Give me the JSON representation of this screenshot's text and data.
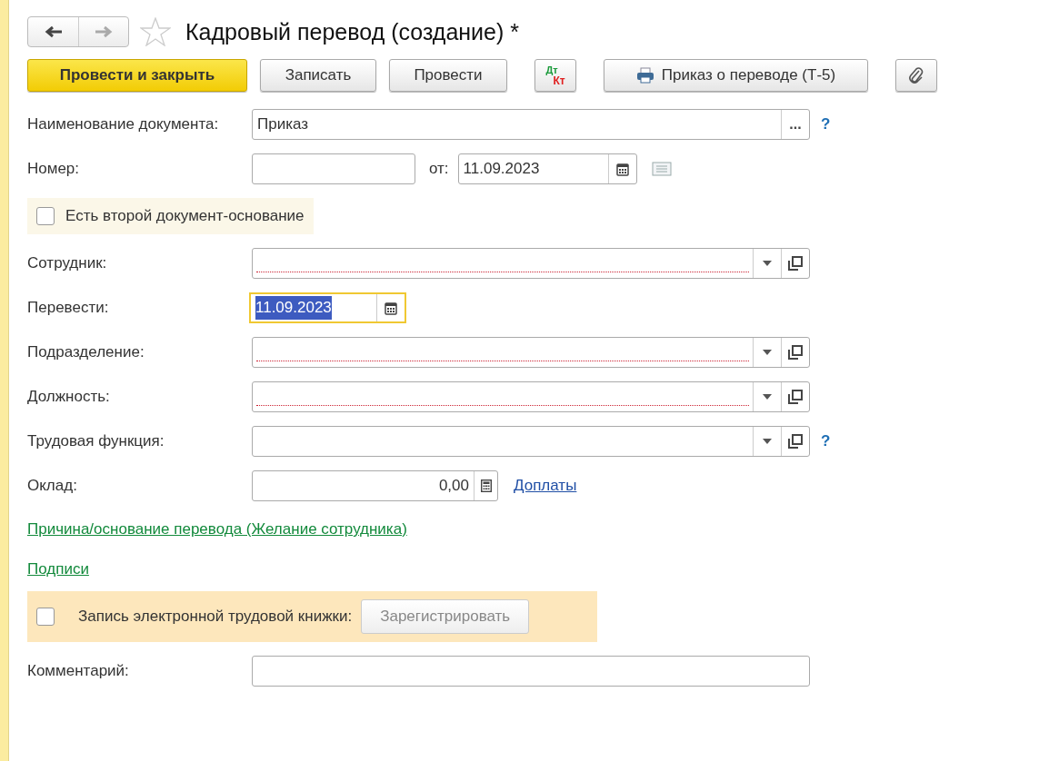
{
  "window": {
    "title": "Кадровый перевод (создание) *"
  },
  "toolbar": [
    {
      "kind": "primary",
      "label": "Провести и закрыть"
    },
    {
      "kind": "plain",
      "label": "Записать"
    },
    {
      "kind": "plain",
      "label": "Провести"
    },
    {
      "kind": "dtkt",
      "label_top": "Дт",
      "label_bottom": "Кт"
    },
    {
      "kind": "print",
      "label": "Приказ о переводе (Т-5)"
    },
    {
      "kind": "attach"
    }
  ],
  "document_name": {
    "label": "Наименование документа:",
    "value": "Приказ",
    "choose": "...",
    "help": "?"
  },
  "number": {
    "label": "Номер:",
    "date_label": "от:",
    "date": "11.09.2023"
  },
  "second_basis": {
    "label": "Есть второй документ-основание",
    "checked": false
  },
  "fields": [
    {
      "kind": "select",
      "label": "Сотрудник:",
      "required": true
    },
    {
      "kind": "date",
      "label": "Перевести:",
      "value": "11.09.2023",
      "focused": true
    },
    {
      "kind": "select",
      "label": "Подразделение:",
      "required": true
    },
    {
      "kind": "select",
      "label": "Должность:",
      "required": true
    },
    {
      "kind": "select",
      "label": "Трудовая функция:",
      "required": false,
      "help": "?"
    },
    {
      "kind": "number",
      "label": "Оклад:",
      "value": "0,00",
      "link": "Доплаты"
    }
  ],
  "links": [
    {
      "label": "Причина/основание перевода (Желание сотрудника)"
    },
    {
      "label": "Подписи"
    }
  ],
  "etk": {
    "label": "Запись электронной трудовой книжки:",
    "checked": false,
    "button": "Зарегистрировать",
    "button_disabled": true
  },
  "comment": {
    "label": "Комментарий:"
  }
}
